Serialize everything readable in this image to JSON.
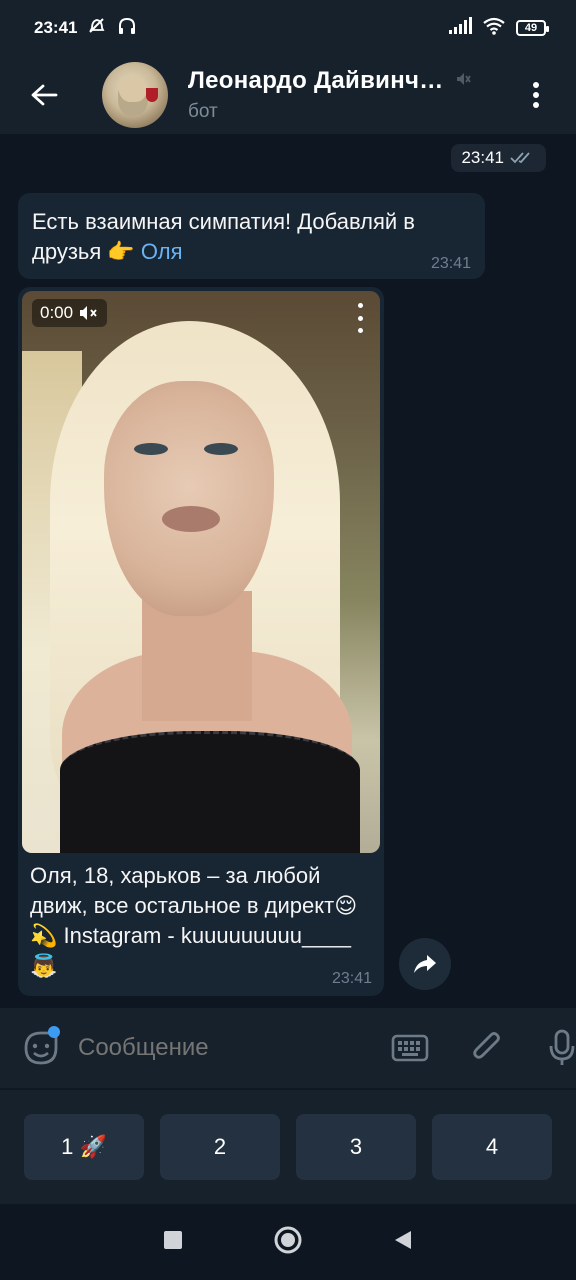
{
  "status_bar": {
    "time": "23:41",
    "battery": "49"
  },
  "header": {
    "title": "Леонардо Дайвинч…",
    "subtitle": "бот"
  },
  "messages": {
    "outgoing_time": "23:41",
    "first": {
      "text_pre": "Есть взаимная симпатия! Добавляй в друзья 👉 ",
      "link": "Оля",
      "time": "23:41"
    },
    "video": {
      "duration": "0:00",
      "caption": "Оля, 18, харьков – за любой движ, все остальное в директ😌💫 Instagram - kuuuuuuuuu____ 👼",
      "time": "23:41"
    }
  },
  "composer": {
    "placeholder": "Сообщение"
  },
  "bot_keyboard": {
    "buttons": [
      "1 🚀",
      "2",
      "3",
      "4"
    ]
  },
  "colors": {
    "background": "#0e1621",
    "header": "#17212b",
    "bubble": "#182533",
    "link": "#6ab3f3",
    "accent": "#3d9cf1"
  }
}
